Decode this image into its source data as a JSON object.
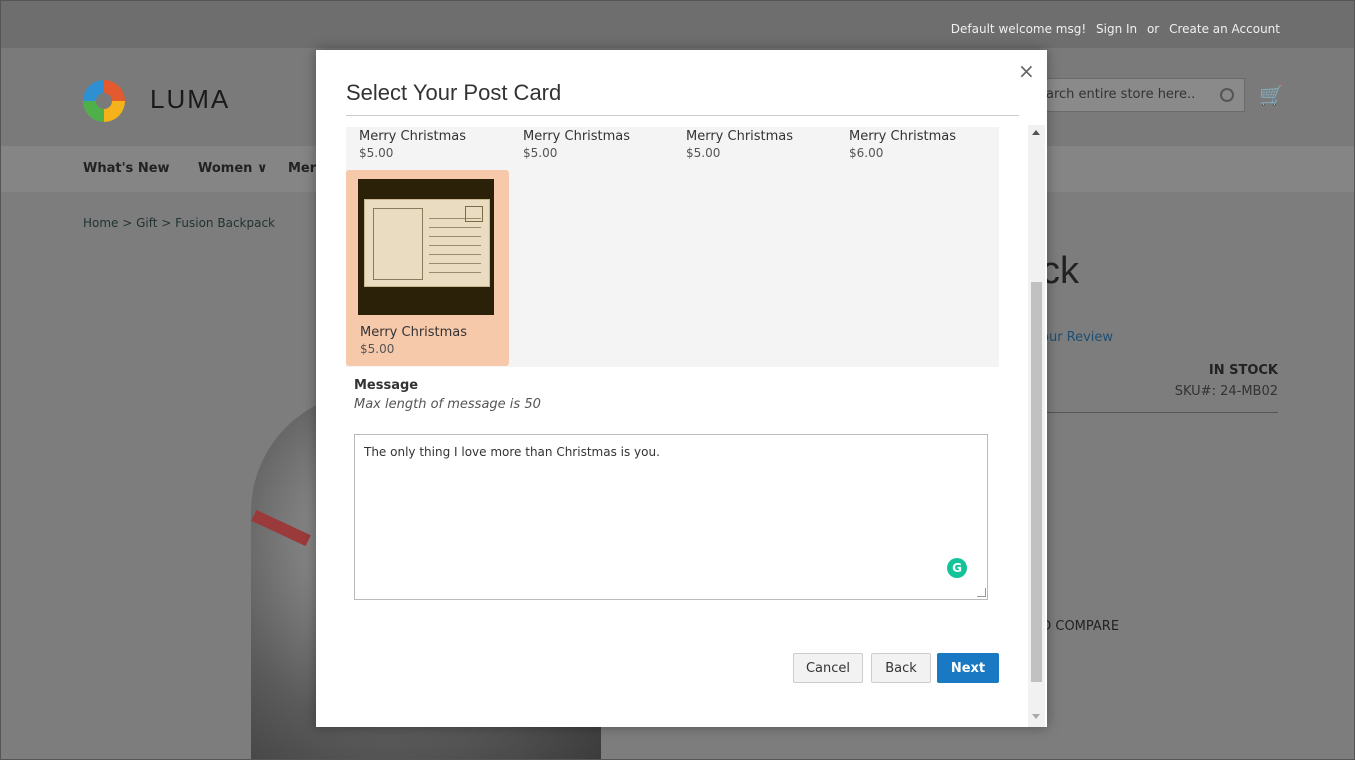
{
  "panel": {
    "welcome": "Default welcome msg!",
    "sign_in": "Sign In",
    "or": "or",
    "create_account": "Create an Account"
  },
  "header": {
    "logo_text": "LUMA",
    "search_placeholder": "arch entire store here..",
    "cart_icon": "cart-icon"
  },
  "nav": {
    "items": [
      "What's New",
      "Women ∨",
      "Mer"
    ]
  },
  "breadcrumb": {
    "text": "Home  >  Gift  >  Fusion Backpack"
  },
  "product": {
    "title_fragment": "ck",
    "review_fragment": "our Review",
    "stock": "IN STOCK",
    "sku": "SKU#:  24-MB02",
    "compare_fragment": "O COMPARE"
  },
  "modal": {
    "title": "Select Your Post Card",
    "close_icon": "×",
    "cards": [
      {
        "name": "Merry Christmas",
        "price": "$5.00"
      },
      {
        "name": "Merry Christmas",
        "price": "$5.00"
      },
      {
        "name": "Merry Christmas",
        "price": "$5.00"
      },
      {
        "name": "Merry Christmas",
        "price": "$6.00"
      }
    ],
    "selected_card": {
      "name": "Merry Christmas",
      "price": "$5.00"
    },
    "message_label": "Message",
    "message_hint": "Max length of message is 50",
    "message_value": "The only thing I love more than Christmas is you.",
    "grammarly_glyph": "G",
    "buttons": {
      "cancel": "Cancel",
      "back": "Back",
      "next": "Next"
    }
  },
  "colors": {
    "selected_card_bg": "#f7c9ab",
    "primary_button": "#1979c3"
  }
}
